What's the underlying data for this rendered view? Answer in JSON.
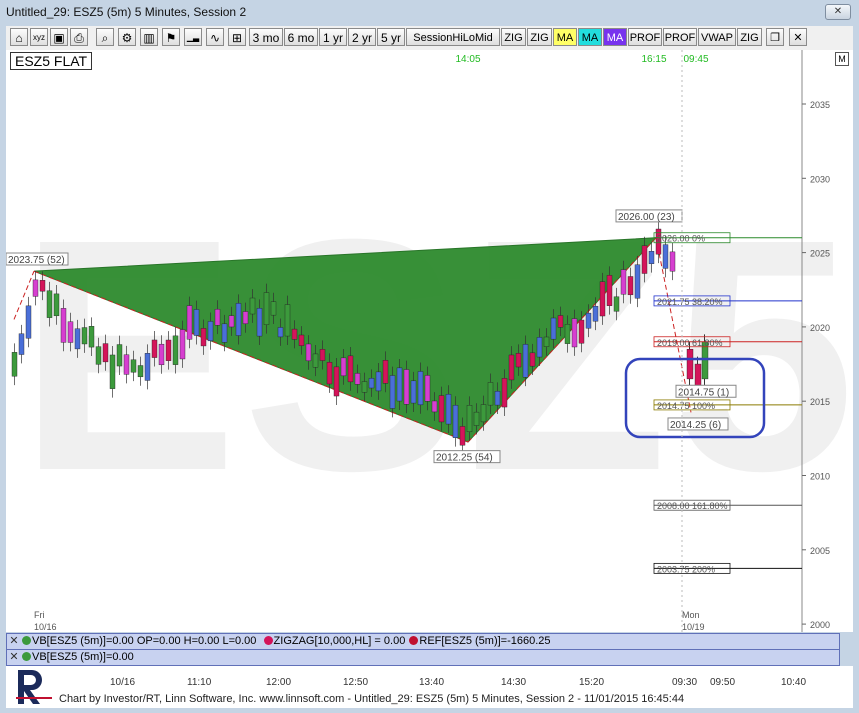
{
  "window": {
    "title": "Untitled_29: ESZ5 (5m) 5 Minutes, Session 2"
  },
  "toolbar": {
    "icons": [
      "home-icon",
      "xyz-chart-icon",
      "lock-icon",
      "print-icon",
      "zoom-icon",
      "gear-icon",
      "candlestick-icon",
      "alarm-icon",
      "ticker-icon",
      "wave-icon",
      "chart-grid-icon"
    ],
    "buttons": [
      "3 mo",
      "6 mo",
      "1 yr",
      "2 yr",
      "5 yr",
      "SessionHiLoMid",
      "ZIG",
      "ZIG",
      "MA",
      "MA",
      "MA",
      "PROF",
      "PROF",
      "VWAP",
      "ZIG"
    ],
    "button_colors": {
      "MA_1": "#ffff66",
      "MA_2": "#22dddd",
      "MA_3": "#7733ee"
    }
  },
  "chart": {
    "symbol_label": "ESZ5 FLAT",
    "watermark": "ESZ5",
    "m_button": "M",
    "y_ticks": [
      "2035",
      "2030",
      "2025",
      "2020",
      "2015",
      "2010",
      "2005",
      "2000"
    ],
    "x_ticks": [
      "10/16",
      "11:10",
      "12:00",
      "12:50",
      "13:40",
      "14:30",
      "15:20",
      "09:30",
      "09:50",
      "10:40"
    ],
    "day_labels": [
      {
        "day": "Fri",
        "date": "10/16"
      },
      {
        "day": "Mon",
        "date": "10/19"
      }
    ],
    "top_times": [
      "14:05",
      "16:15",
      "09:45"
    ],
    "pattern_labels": {
      "x_point": "2023.75 (52)",
      "a_point": "2012.25 (54)",
      "b_point": "2026.00 (23)",
      "c_point": "2014.75 (1)",
      "d_point": "2014.25 (6)"
    },
    "fib_levels": [
      {
        "label": "2026.00 0%",
        "price": 2026.0,
        "color": "#2a8a2a"
      },
      {
        "label": "2021.75 38.20%",
        "price": 2021.75,
        "color": "#2233cc"
      },
      {
        "label": "2019.00 61.80%",
        "price": 2019.0,
        "color": "#cc2222"
      },
      {
        "label": "2014.75 100%",
        "price": 2014.75,
        "color": "#8a7a00"
      },
      {
        "label": "2008.00 161.80%",
        "price": 2008.0,
        "color": "#555555"
      },
      {
        "label": "2003.75 200%",
        "price": 2003.75,
        "color": "#111111"
      }
    ]
  },
  "status_lines": {
    "line1": {
      "vb": "VB[ESZ5 (5m)]=0.00 OP=0.00 H=0.00 L=0.00",
      "zigzag": "ZIGZAG[10,000,HL] = 0.00",
      "ref": "REF[ESZ5 (5m)]=-1660.25"
    },
    "line2": {
      "vb": "VB[ESZ5 (5m)]=0.00"
    }
  },
  "footer": {
    "text": "Chart by Investor/RT, Linn Software, Inc.  www.linnsoft.com - Untitled_29: ESZ5 (5m) 5 Minutes, Session 2 - 11/01/2015 16:45:44"
  },
  "colors": {
    "pattern_fill": "#2e8b2e",
    "up_candle": "#3c9a3c",
    "down_candle": "#d4145a",
    "blue_candle": "#4a6fd8",
    "magenta_candle": "#d63fd0"
  }
}
